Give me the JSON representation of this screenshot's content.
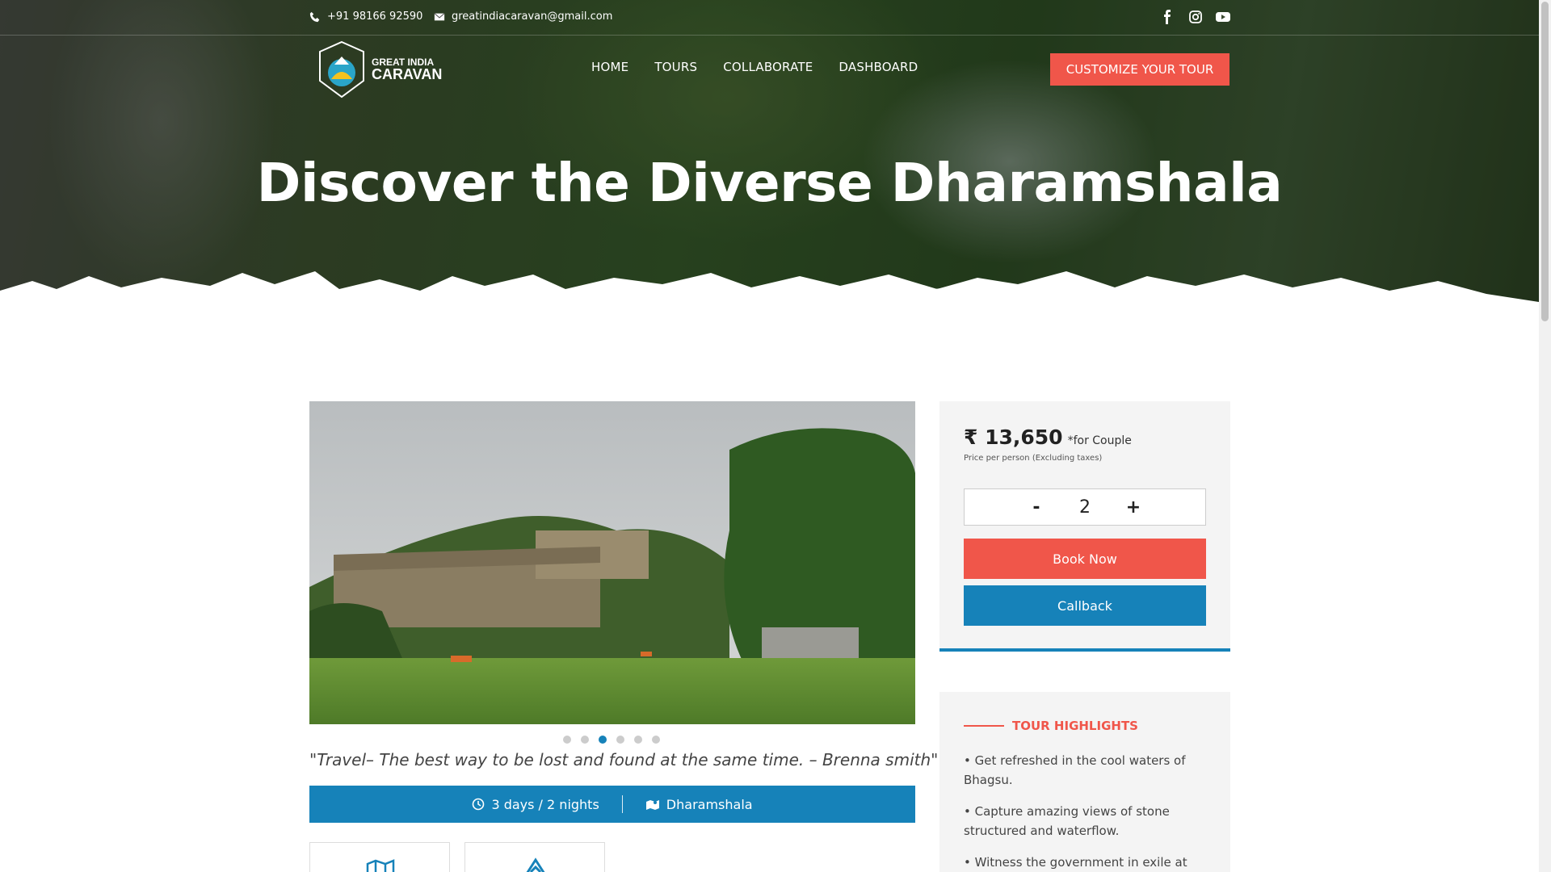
{
  "topbar": {
    "phone": "+91 98166 92590",
    "email": "greatindiacaravan@gmail.com",
    "social": [
      "facebook-icon",
      "instagram-icon",
      "youtube-icon"
    ]
  },
  "logo": {
    "line1": "GREAT INDIA",
    "line2": "CARAVAN"
  },
  "nav": {
    "home": "HOME",
    "tours": "TOURS",
    "collaborate": "COLLABORATE",
    "dashboard": "DASHBOARD"
  },
  "cta": "CUSTOMIZE YOUR TOUR",
  "hero": {
    "title": "Discover the Diverse Dharamshala"
  },
  "gallery": {
    "slide_count": 6,
    "active_slide": 3
  },
  "quote": "\"Travel– The best way to be lost and found at the same time. – Brenna smith\"",
  "info": {
    "duration": "3 days / 2 nights",
    "location": "Dharamshala"
  },
  "tiles": [
    "map-icon",
    "mountain-icon"
  ],
  "pricing": {
    "amount": "₹ 13,650",
    "per": "*for Couple",
    "note": "Price per person (Excluding taxes)",
    "quantity": "2",
    "minus": "-",
    "plus": "+",
    "book_label": "Book Now",
    "callback_label": "Callback"
  },
  "highlights": {
    "heading": "TOUR HIGHLIGHTS",
    "items": [
      "• Get refreshed in the cool waters of Bhagsu.",
      "• Capture amazing views of stone structured and waterflow.",
      "• Witness the government in exile at Dalai"
    ]
  },
  "colors": {
    "accent": "#f0564a",
    "primary": "#1682b9"
  }
}
